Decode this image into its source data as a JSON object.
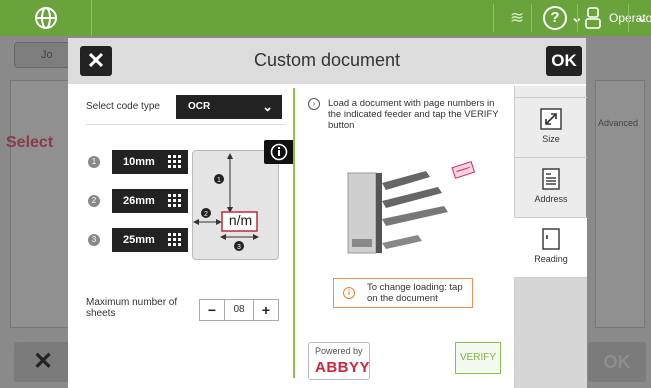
{
  "topbar": {
    "user_label": "Operator"
  },
  "background": {
    "back_label": "Jo",
    "select_label": "Select",
    "advanced_label": "Advanced"
  },
  "dialog": {
    "title": "Custom document",
    "close_icon": "close-icon",
    "ok_label": "OK",
    "code_type_label": "Select code type",
    "code_type_value": "OCR",
    "positions": [
      {
        "number": "1",
        "value": "10mm"
      },
      {
        "number": "2",
        "value": "26mm"
      },
      {
        "number": "3",
        "value": "25mm"
      }
    ],
    "illustration_text": "n/m",
    "max_sheets_label": "Maximum number of sheets",
    "max_sheets_value": "08",
    "minus_label": "−",
    "plus_label": "+",
    "instructions": "Load a document with page numbers in the indicated feeder and tap the VERIFY button",
    "notice": "To change loading: tap on the document",
    "powered_by": "Powered by",
    "abbyy_logo": "ABBYY",
    "verify_label": "VERIFY",
    "tabs": [
      {
        "label": "Size",
        "icon": "resize-icon"
      },
      {
        "label": "Address",
        "icon": "address-doc-icon"
      },
      {
        "label": "Reading",
        "icon": "reading-doc-icon"
      }
    ]
  },
  "colors": {
    "accent": "#6aa23c",
    "warning": "#f08030",
    "brand_red": "#d0253a"
  }
}
